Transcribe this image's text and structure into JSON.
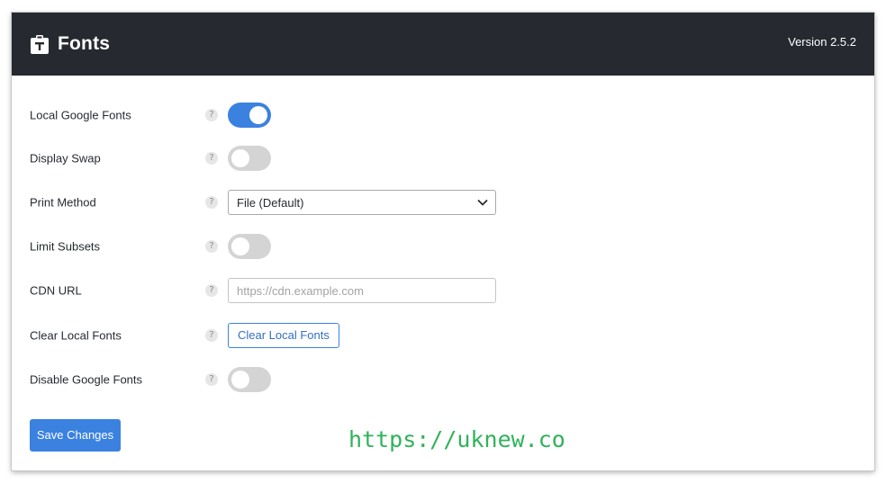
{
  "header": {
    "title": "Fonts",
    "version": "Version 2.5.2",
    "icon": "clipboard-font-icon"
  },
  "settings": [
    {
      "label": "Local Google Fonts",
      "type": "toggle",
      "enabled": true
    },
    {
      "label": "Display Swap",
      "type": "toggle",
      "enabled": false
    },
    {
      "label": "Print Method",
      "type": "select",
      "value": "File (Default)"
    },
    {
      "label": "Limit Subsets",
      "type": "toggle",
      "enabled": false
    },
    {
      "label": "CDN URL",
      "type": "text",
      "value": "",
      "placeholder": "https://cdn.example.com"
    },
    {
      "label": "Clear Local Fonts",
      "type": "button",
      "button_label": "Clear Local Fonts"
    },
    {
      "label": "Disable Google Fonts",
      "type": "toggle",
      "enabled": false
    }
  ],
  "help_glyph": "?",
  "save_label": "Save Changes",
  "watermark": "https://uknew.co",
  "colors": {
    "header_bg": "#262a30",
    "accent": "#3b82e0",
    "toggle_off": "#d4d4d4",
    "watermark": "#2fb35a"
  }
}
